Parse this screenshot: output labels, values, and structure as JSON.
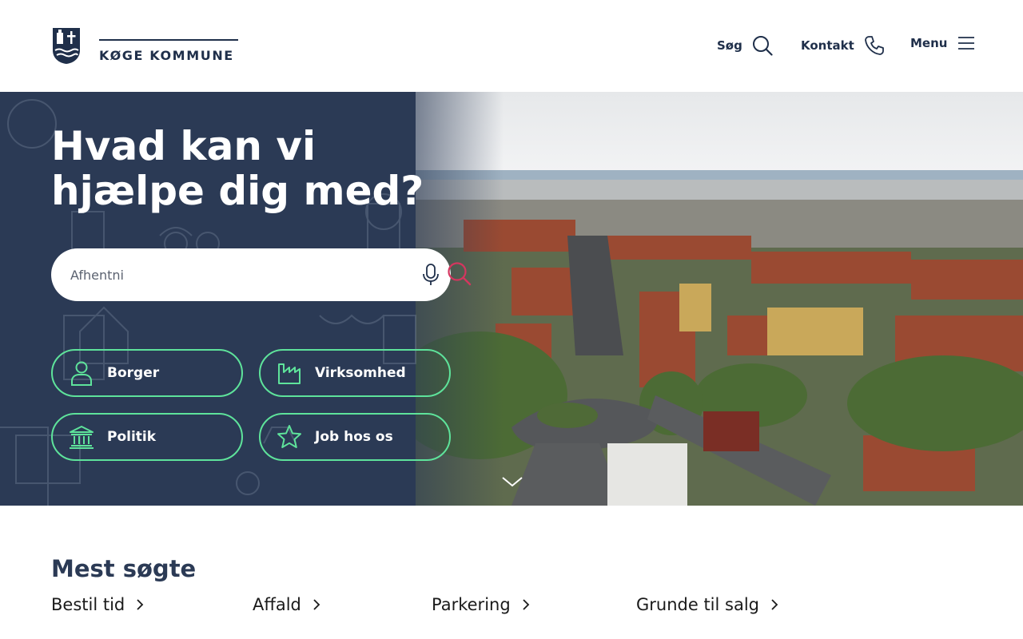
{
  "header": {
    "logo_text": "KØGE KOMMUNE",
    "nav": {
      "search_label": "Søg",
      "contact_label": "Kontakt",
      "menu_label": "Menu"
    }
  },
  "hero": {
    "title": "Hvad kan vi hjælpe dig med?",
    "search": {
      "value": "",
      "placeholder": "Afhentni"
    },
    "categories": [
      {
        "label": "Borger",
        "icon": "person-icon"
      },
      {
        "label": "Virksomhed",
        "icon": "factory-icon"
      },
      {
        "label": "Politik",
        "icon": "government-building-icon"
      },
      {
        "label": "Job hos os",
        "icon": "star-icon"
      }
    ]
  },
  "most_searched": {
    "title": "Mest søgte",
    "links": [
      {
        "label": "Bestil tid"
      },
      {
        "label": "Affald"
      },
      {
        "label": "Parkering"
      },
      {
        "label": "Grunde til salg"
      }
    ]
  },
  "colors": {
    "navy": "#2b3a55",
    "accent_green": "#5ee39b",
    "search_pink": "#d4365f",
    "text_dark": "#1f2f4a"
  }
}
